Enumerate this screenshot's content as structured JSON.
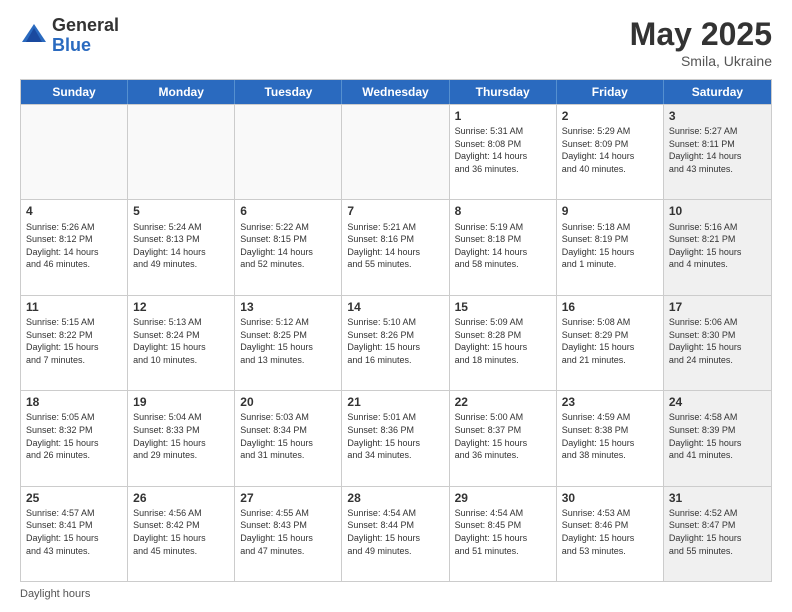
{
  "header": {
    "logo_general": "General",
    "logo_blue": "Blue",
    "title": "May 2025",
    "location": "Smila, Ukraine"
  },
  "footer": {
    "label": "Daylight hours"
  },
  "days_of_week": [
    "Sunday",
    "Monday",
    "Tuesday",
    "Wednesday",
    "Thursday",
    "Friday",
    "Saturday"
  ],
  "weeks": [
    [
      {
        "day": "",
        "info": "",
        "empty": true
      },
      {
        "day": "",
        "info": "",
        "empty": true
      },
      {
        "day": "",
        "info": "",
        "empty": true
      },
      {
        "day": "",
        "info": "",
        "empty": true
      },
      {
        "day": "1",
        "info": "Sunrise: 5:31 AM\nSunset: 8:08 PM\nDaylight: 14 hours\nand 36 minutes."
      },
      {
        "day": "2",
        "info": "Sunrise: 5:29 AM\nSunset: 8:09 PM\nDaylight: 14 hours\nand 40 minutes."
      },
      {
        "day": "3",
        "info": "Sunrise: 5:27 AM\nSunset: 8:11 PM\nDaylight: 14 hours\nand 43 minutes.",
        "shaded": true
      }
    ],
    [
      {
        "day": "4",
        "info": "Sunrise: 5:26 AM\nSunset: 8:12 PM\nDaylight: 14 hours\nand 46 minutes."
      },
      {
        "day": "5",
        "info": "Sunrise: 5:24 AM\nSunset: 8:13 PM\nDaylight: 14 hours\nand 49 minutes."
      },
      {
        "day": "6",
        "info": "Sunrise: 5:22 AM\nSunset: 8:15 PM\nDaylight: 14 hours\nand 52 minutes."
      },
      {
        "day": "7",
        "info": "Sunrise: 5:21 AM\nSunset: 8:16 PM\nDaylight: 14 hours\nand 55 minutes."
      },
      {
        "day": "8",
        "info": "Sunrise: 5:19 AM\nSunset: 8:18 PM\nDaylight: 14 hours\nand 58 minutes."
      },
      {
        "day": "9",
        "info": "Sunrise: 5:18 AM\nSunset: 8:19 PM\nDaylight: 15 hours\nand 1 minute."
      },
      {
        "day": "10",
        "info": "Sunrise: 5:16 AM\nSunset: 8:21 PM\nDaylight: 15 hours\nand 4 minutes.",
        "shaded": true
      }
    ],
    [
      {
        "day": "11",
        "info": "Sunrise: 5:15 AM\nSunset: 8:22 PM\nDaylight: 15 hours\nand 7 minutes."
      },
      {
        "day": "12",
        "info": "Sunrise: 5:13 AM\nSunset: 8:24 PM\nDaylight: 15 hours\nand 10 minutes."
      },
      {
        "day": "13",
        "info": "Sunrise: 5:12 AM\nSunset: 8:25 PM\nDaylight: 15 hours\nand 13 minutes."
      },
      {
        "day": "14",
        "info": "Sunrise: 5:10 AM\nSunset: 8:26 PM\nDaylight: 15 hours\nand 16 minutes."
      },
      {
        "day": "15",
        "info": "Sunrise: 5:09 AM\nSunset: 8:28 PM\nDaylight: 15 hours\nand 18 minutes."
      },
      {
        "day": "16",
        "info": "Sunrise: 5:08 AM\nSunset: 8:29 PM\nDaylight: 15 hours\nand 21 minutes."
      },
      {
        "day": "17",
        "info": "Sunrise: 5:06 AM\nSunset: 8:30 PM\nDaylight: 15 hours\nand 24 minutes.",
        "shaded": true
      }
    ],
    [
      {
        "day": "18",
        "info": "Sunrise: 5:05 AM\nSunset: 8:32 PM\nDaylight: 15 hours\nand 26 minutes."
      },
      {
        "day": "19",
        "info": "Sunrise: 5:04 AM\nSunset: 8:33 PM\nDaylight: 15 hours\nand 29 minutes."
      },
      {
        "day": "20",
        "info": "Sunrise: 5:03 AM\nSunset: 8:34 PM\nDaylight: 15 hours\nand 31 minutes."
      },
      {
        "day": "21",
        "info": "Sunrise: 5:01 AM\nSunset: 8:36 PM\nDaylight: 15 hours\nand 34 minutes."
      },
      {
        "day": "22",
        "info": "Sunrise: 5:00 AM\nSunset: 8:37 PM\nDaylight: 15 hours\nand 36 minutes."
      },
      {
        "day": "23",
        "info": "Sunrise: 4:59 AM\nSunset: 8:38 PM\nDaylight: 15 hours\nand 38 minutes."
      },
      {
        "day": "24",
        "info": "Sunrise: 4:58 AM\nSunset: 8:39 PM\nDaylight: 15 hours\nand 41 minutes.",
        "shaded": true
      }
    ],
    [
      {
        "day": "25",
        "info": "Sunrise: 4:57 AM\nSunset: 8:41 PM\nDaylight: 15 hours\nand 43 minutes."
      },
      {
        "day": "26",
        "info": "Sunrise: 4:56 AM\nSunset: 8:42 PM\nDaylight: 15 hours\nand 45 minutes."
      },
      {
        "day": "27",
        "info": "Sunrise: 4:55 AM\nSunset: 8:43 PM\nDaylight: 15 hours\nand 47 minutes."
      },
      {
        "day": "28",
        "info": "Sunrise: 4:54 AM\nSunset: 8:44 PM\nDaylight: 15 hours\nand 49 minutes."
      },
      {
        "day": "29",
        "info": "Sunrise: 4:54 AM\nSunset: 8:45 PM\nDaylight: 15 hours\nand 51 minutes."
      },
      {
        "day": "30",
        "info": "Sunrise: 4:53 AM\nSunset: 8:46 PM\nDaylight: 15 hours\nand 53 minutes."
      },
      {
        "day": "31",
        "info": "Sunrise: 4:52 AM\nSunset: 8:47 PM\nDaylight: 15 hours\nand 55 minutes.",
        "shaded": true
      }
    ]
  ]
}
